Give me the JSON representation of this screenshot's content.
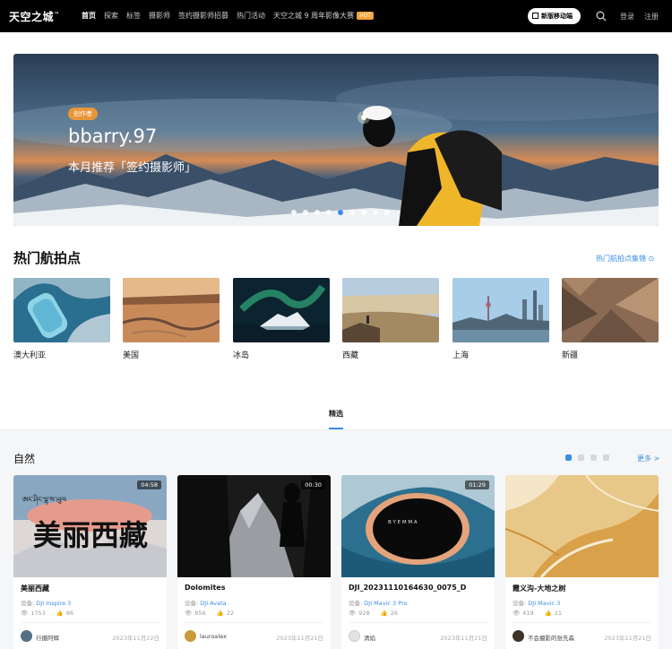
{
  "nav": {
    "logo": "天空之城",
    "logo_tm": "™",
    "items": [
      "首页",
      "探索",
      "标签",
      "摄影师",
      "签约摄影师招募",
      "热门活动",
      "天空之城 9 周年影像大赛"
    ],
    "hot_badge": "HOT",
    "mobile_button": "新版移动端",
    "login": "登录",
    "register": "注册"
  },
  "hero": {
    "tag": "创作者",
    "name": "bbarry.97",
    "subtitle": "本月推荐「签约摄影师」",
    "slide_count": 9,
    "active_slide": 5
  },
  "hotspots": {
    "title": "热门航拍点",
    "link": "热门航拍点集锦",
    "items": [
      "澳大利亚",
      "美国",
      "冰岛",
      "西藏",
      "上海",
      "新疆"
    ]
  },
  "tabs": {
    "featured": "精选"
  },
  "nature": {
    "title": "自然",
    "more": "更多 >",
    "device_prefix": "设备:",
    "cards": [
      {
        "title": "美丽西藏",
        "device": "DJI Inspire 3",
        "views": "1753",
        "likes": "86",
        "author": "行摄阿辉",
        "date": "2023年11月22日",
        "duration": "04:58"
      },
      {
        "title": "Dolomites",
        "device": "DJI Avata",
        "views": "856",
        "likes": "22",
        "author": "lauroalex",
        "date": "2023年11月21日",
        "duration": "00:30"
      },
      {
        "title": "DJI_20231110164630_0075_D",
        "device": "DJI Mavic 3 Pro",
        "views": "928",
        "likes": "26",
        "author": "清焰",
        "date": "2023年11月21日",
        "duration": "01:29"
      },
      {
        "title": "霞义沟-大地之树",
        "device": "DJI Mavic 3",
        "views": "419",
        "likes": "21",
        "author": "不会摄影的张先森",
        "date": "2023年11月21日",
        "duration": ""
      }
    ],
    "thumb_overlay_text": "美丽西藏",
    "thumb_overlay_script": "ཨང་ཤིང་ལྷ་ས་ཡུལ",
    "thumb3_watermark": "B Y  E M M A"
  }
}
